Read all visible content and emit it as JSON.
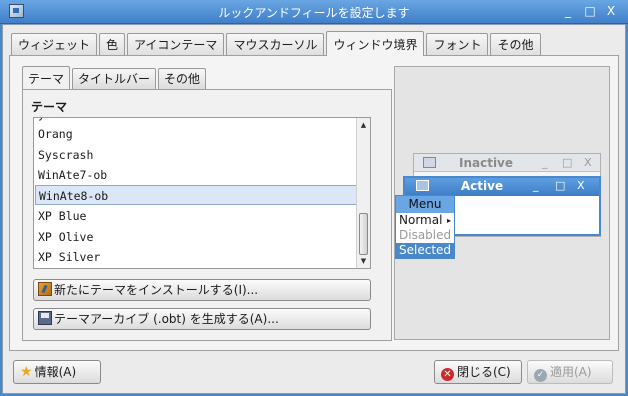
{
  "window": {
    "title": "ルックアンドフィールを設定します",
    "minimize": "_",
    "maximize": "□",
    "close": "X"
  },
  "main_tabs": [
    "ウィジェット",
    "色",
    "アイコンテーマ",
    "マウスカーソル",
    "ウィンドウ境界",
    "フォント",
    "その他"
  ],
  "main_tab_active": "ウィンドウ境界",
  "inner_tabs": [
    "テーマ",
    "タイトルバー",
    "その他"
  ],
  "inner_tab_active": "テーマ",
  "section_title": "テーマ",
  "themes": [
    "Orang",
    "Syscrash",
    "WinAte7-ob",
    "WinAte8-ob",
    "XP Blue",
    "XP Olive",
    "XP Silver"
  ],
  "selected_theme": "WinAte8-ob",
  "buttons": {
    "install": "新たにテーマをインストールする(I)...",
    "archive": "テーマアーカイブ (.obt) を生成する(A)...",
    "info": "情報(A)",
    "close": "閉じる(C)",
    "apply": "適用(A)"
  },
  "preview": {
    "inactive_title": "Inactive",
    "active_title": "Active",
    "menu_title": "Menu",
    "menu_items": [
      "Normal",
      "Disabled",
      "Selected"
    ]
  },
  "colors": {
    "titlebar": "#4a86c8",
    "selection": "#dbe7f6",
    "menu_selected": "#4a88cc"
  }
}
